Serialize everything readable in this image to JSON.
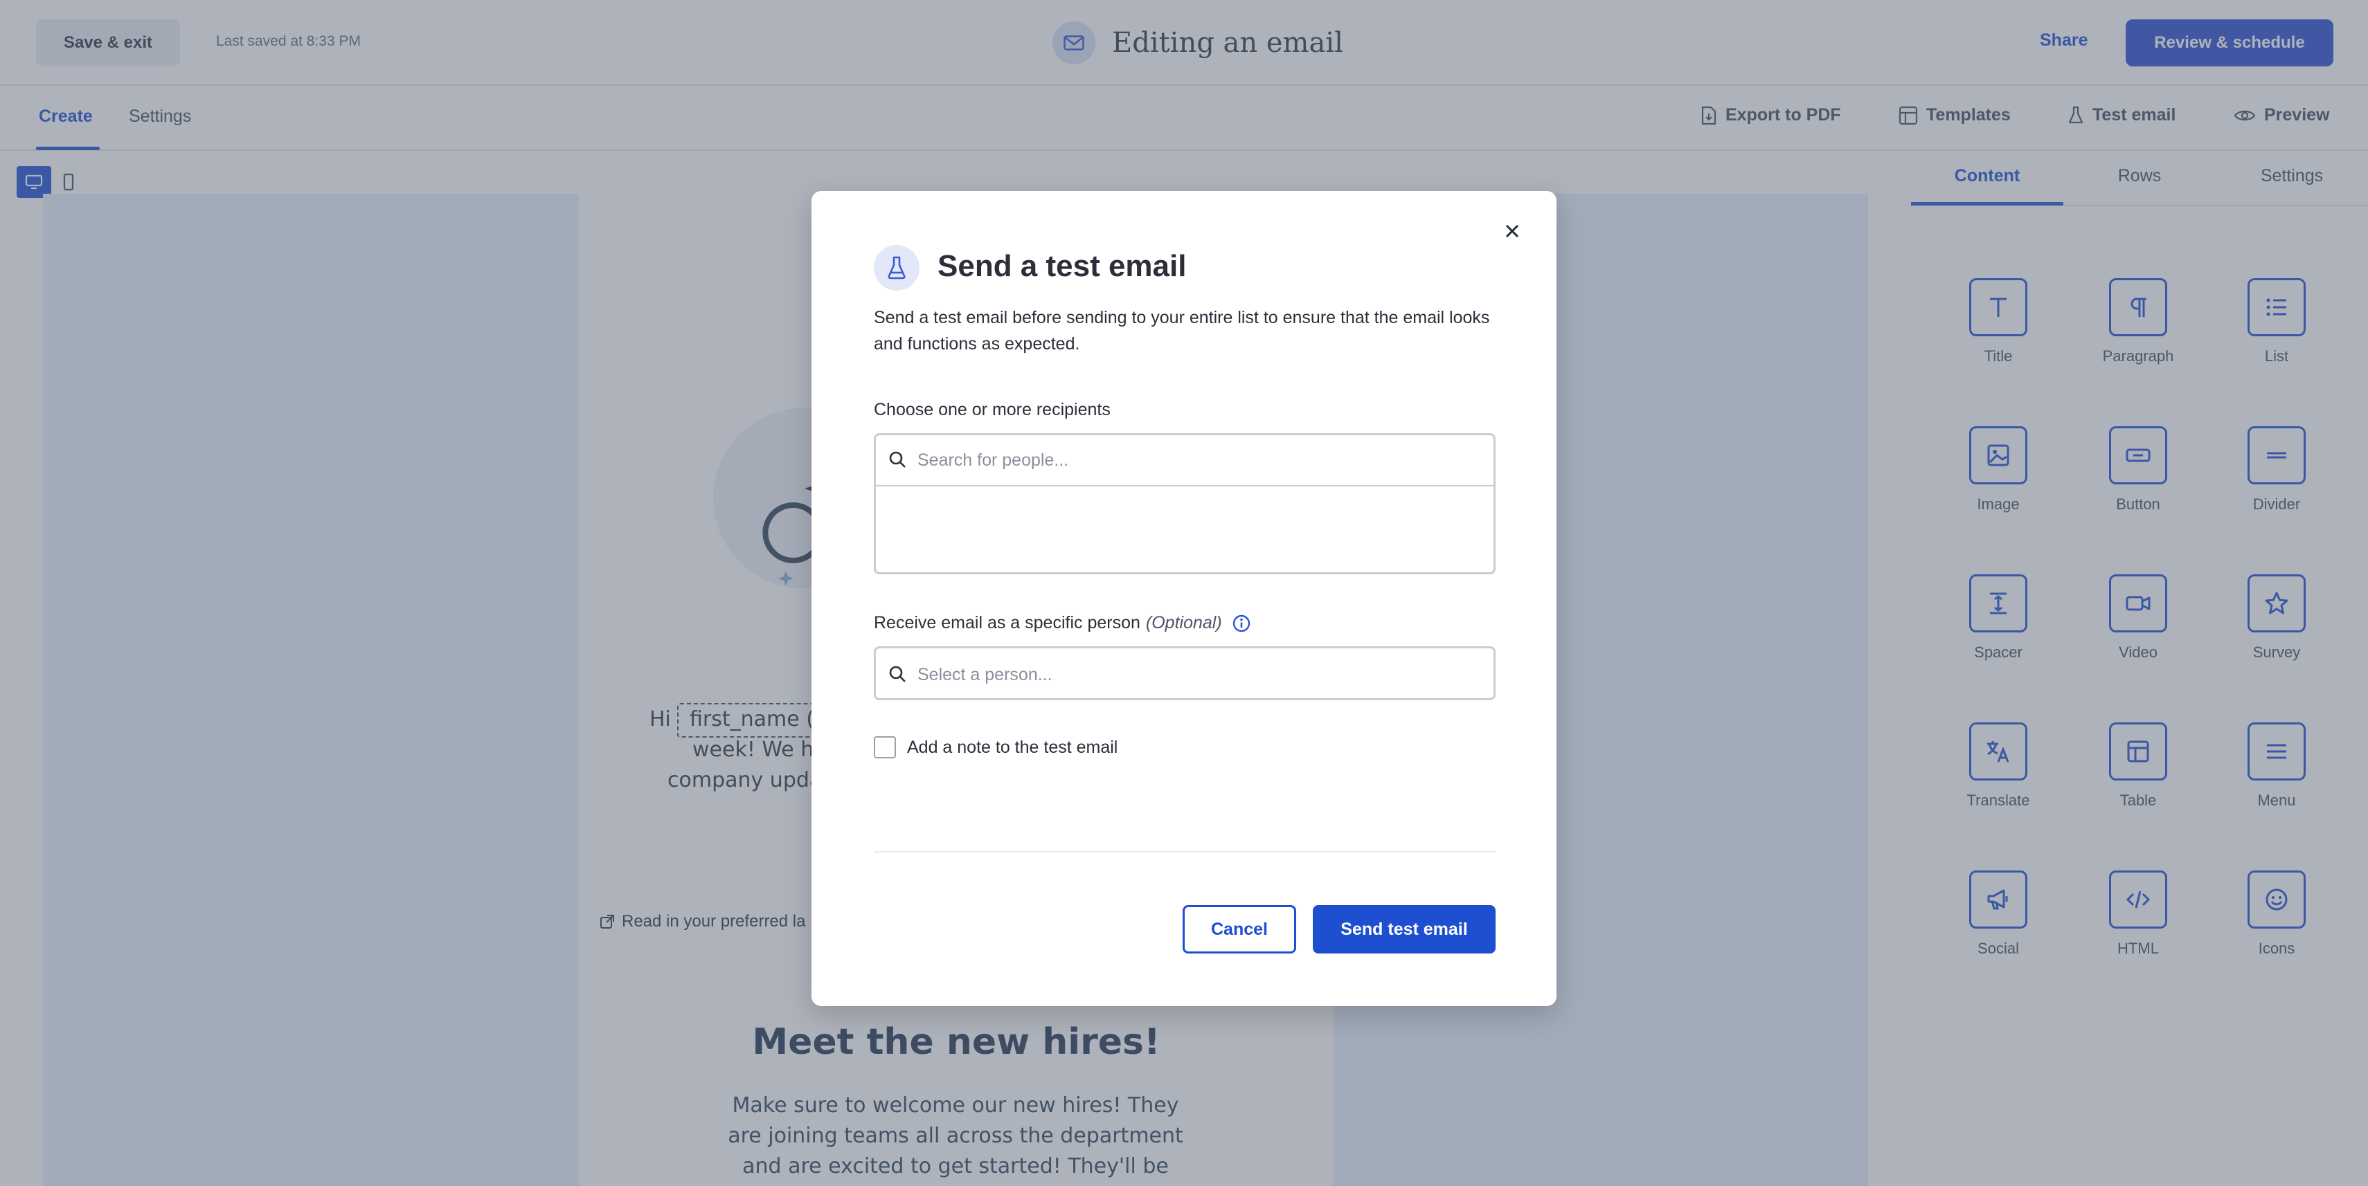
{
  "header": {
    "save_exit_label": "Save & exit",
    "last_saved": "Last saved at 8:33 PM",
    "title": "Editing an email",
    "title_icon": "envelope-icon",
    "share_label": "Share",
    "review_label": "Review & schedule"
  },
  "subnav": {
    "tabs": [
      {
        "label": "Create",
        "active": true
      },
      {
        "label": "Settings",
        "active": false
      }
    ],
    "tools": [
      {
        "label": "Export to PDF",
        "icon": "file-export-icon"
      },
      {
        "label": "Templates",
        "icon": "layout-icon"
      },
      {
        "label": "Test email",
        "icon": "flask-icon"
      },
      {
        "label": "Preview",
        "icon": "eye-icon"
      }
    ]
  },
  "email": {
    "greeting_prefix": "Hi",
    "merge_tag": "first_name (e",
    "line2": "week! We ha",
    "line3": "company upda",
    "preferred_language": "Read in your preferred la",
    "section_title": "Meet the new hires!",
    "section_text": "Make sure to welcome our new hires! They are joining teams all across the department and are excited to get started! They'll be done with"
  },
  "panel": {
    "tabs": [
      {
        "label": "Content",
        "active": true
      },
      {
        "label": "Rows",
        "active": false
      },
      {
        "label": "Settings",
        "active": false
      }
    ],
    "blocks": [
      {
        "label": "Title",
        "icon": "title-icon"
      },
      {
        "label": "Paragraph",
        "icon": "paragraph-icon"
      },
      {
        "label": "List",
        "icon": "list-icon"
      },
      {
        "label": "Image",
        "icon": "image-icon"
      },
      {
        "label": "Button",
        "icon": "button-icon"
      },
      {
        "label": "Divider",
        "icon": "divider-icon"
      },
      {
        "label": "Spacer",
        "icon": "spacer-icon"
      },
      {
        "label": "Video",
        "icon": "video-icon"
      },
      {
        "label": "Survey",
        "icon": "star-icon"
      },
      {
        "label": "Translate",
        "icon": "translate-icon"
      },
      {
        "label": "Table",
        "icon": "table-icon"
      },
      {
        "label": "Menu",
        "icon": "menu-icon"
      },
      {
        "label": "Social",
        "icon": "megaphone-icon"
      },
      {
        "label": "HTML",
        "icon": "code-icon"
      },
      {
        "label": "Icons",
        "icon": "smiley-icon"
      }
    ]
  },
  "modal": {
    "title": "Send a test email",
    "description": "Send a test email before sending to your entire list to ensure that the email looks and functions as expected.",
    "recipients_label": "Choose one or more recipients",
    "recipients_placeholder": "Search for people...",
    "recipients_value": "",
    "person_label": "Receive email as a specific person",
    "person_optional": "(Optional)",
    "person_placeholder": "Select a person...",
    "person_value": "",
    "note_label": "Add a note to the test email",
    "note_checked": false,
    "cancel_label": "Cancel",
    "send_label": "Send test email"
  },
  "colors": {
    "primary": "#1e4fd0",
    "overlay": "#505c6e"
  }
}
